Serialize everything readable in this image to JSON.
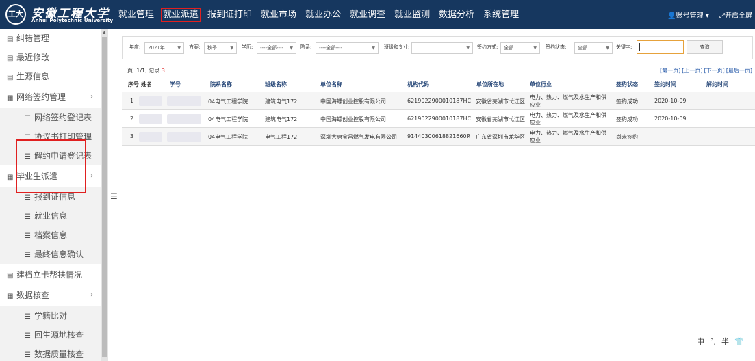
{
  "header": {
    "logo_mark": "工大",
    "logo_cn": "安徽工程大学",
    "logo_en": "Anhui Polytechnic University",
    "nav": [
      "就业管理",
      "就业派遣",
      "报到证打印",
      "就业市场",
      "就业办公",
      "就业调查",
      "就业监测",
      "数据分析",
      "系统管理"
    ],
    "active_nav": "就业派遣",
    "account_menu": "账号管理",
    "open_full": "开启全屏"
  },
  "sidebar": {
    "items": [
      {
        "label": "纠错管理",
        "icon": "list-icon"
      },
      {
        "label": "最近修改",
        "icon": "list-icon"
      },
      {
        "label": "生源信息",
        "icon": "list-icon"
      },
      {
        "label": "网络签约管理",
        "icon": "grid-icon",
        "expandable": true
      },
      {
        "label": "网络签约登记表",
        "icon": "doc-icon",
        "sub": true
      },
      {
        "label": "协议书打印管理",
        "icon": "doc-icon",
        "sub": true
      },
      {
        "label": "解约申请登记表",
        "icon": "doc-icon",
        "sub": true
      },
      {
        "label": "毕业生派遣",
        "icon": "grid-icon",
        "expandable": true
      },
      {
        "label": "报到证信息",
        "icon": "doc-icon",
        "sub": true
      },
      {
        "label": "就业信息",
        "icon": "doc-icon",
        "sub": true
      },
      {
        "label": "档案信息",
        "icon": "doc-icon",
        "sub": true
      },
      {
        "label": "最终信息确认",
        "icon": "doc-icon",
        "sub": true
      },
      {
        "label": "建档立卡帮扶情况",
        "icon": "list-icon"
      },
      {
        "label": "数据核查",
        "icon": "grid-icon",
        "expandable": true
      },
      {
        "label": "学籍比对",
        "icon": "doc-icon",
        "sub": true
      },
      {
        "label": "回生源地核查",
        "icon": "doc-icon",
        "sub": true
      },
      {
        "label": "数据质量核查",
        "icon": "doc-icon",
        "sub": true
      }
    ]
  },
  "filters": {
    "year_label": "年度:",
    "year_value": "2021年",
    "plan_label": "方案:",
    "plan_value": "秋季",
    "edu_label": "学历:",
    "edu_value": "----全部----",
    "dept_label": "院系:",
    "dept_value": "----全部----",
    "class_label": "班级和专业:",
    "class_value": "",
    "sign_method_label": "签约方式:",
    "sign_method_value": "全部",
    "sign_status_label": "签约状态:",
    "sign_status_value": "全部",
    "keyword_label": "关键字:",
    "keyword_value": "",
    "query_button": "查询"
  },
  "pagination": {
    "page_text": "页: 1/1, 记录:",
    "record_count": "3",
    "first": "[第一页]",
    "prev": "[上一页]",
    "next": "[下一页]",
    "last": "[最后一页]"
  },
  "table": {
    "headers": [
      "序号",
      "姓名",
      "学号",
      "院系名称",
      "班级名称",
      "单位名称",
      "机构代码",
      "单位所在地",
      "单位行业",
      "签约状态",
      "签约时间",
      "解约时间"
    ],
    "rows": [
      {
        "no": "1",
        "dept": "04电气工程学院",
        "class": "建筑电气172",
        "company": "中国海螺创业控股有限公司",
        "code": "6219022900010187HC",
        "location": "安徽省芜湖市弋江区",
        "industry": "电力、热力、燃气及水生产和供应业",
        "status": "签约成功",
        "sign_time": "2020-10-09",
        "cancel_time": ""
      },
      {
        "no": "2",
        "dept": "04电气工程学院",
        "class": "建筑电气172",
        "company": "中国海螺创业控股有限公司",
        "code": "6219022900010187HC",
        "location": "安徽省芜湖市弋江区",
        "industry": "电力、热力、燃气及水生产和供应业",
        "status": "签约成功",
        "sign_time": "2020-10-09",
        "cancel_time": ""
      },
      {
        "no": "3",
        "dept": "04电气工程学院",
        "class": "电气工程172",
        "company": "深圳大唐宝昌燃气发电有限公司",
        "code": "91440300618821660R",
        "location": "广东省深圳市龙华区",
        "industry": "电力、热力、燃气及水生产和供应业",
        "status": "尚未签约",
        "sign_time": "",
        "cancel_time": ""
      }
    ]
  },
  "ime": {
    "lang": "中",
    "punct": "°,",
    "width": "半"
  }
}
